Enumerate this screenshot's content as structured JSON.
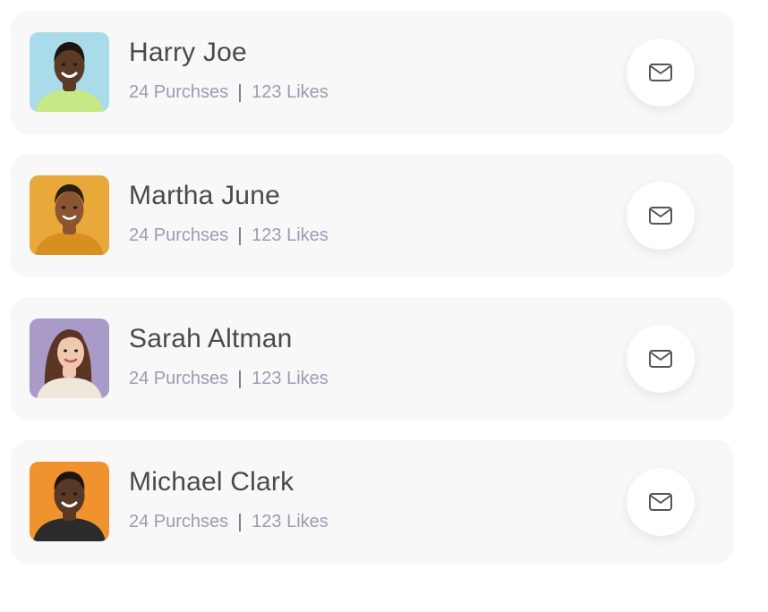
{
  "contacts": [
    {
      "name": "Harry Joe",
      "purchases": "24 Purchses",
      "likes": "123 Likes",
      "avatar_icon": "person-avatar",
      "avatar_bg": "#a9dbeb",
      "avatar_shirt": "#c6e887",
      "avatar_skin": "#5b3a26",
      "avatar_hair": "#1c1410",
      "mail_icon": "mail-icon"
    },
    {
      "name": "Martha June",
      "purchases": "24 Purchses",
      "likes": "123 Likes",
      "avatar_icon": "person-avatar",
      "avatar_bg": "#e9a93a",
      "avatar_shirt": "#d88f22",
      "avatar_skin": "#8a5530",
      "avatar_hair": "#2a1d14",
      "mail_icon": "mail-icon"
    },
    {
      "name": "Sarah Altman",
      "purchases": "24 Purchses",
      "likes": "123 Likes",
      "avatar_icon": "person-avatar",
      "avatar_bg": "#a99ac7",
      "avatar_shirt": "#efe7dc",
      "avatar_skin": "#f0c8ad",
      "avatar_hair": "#5b3424",
      "mail_icon": "mail-icon"
    },
    {
      "name": "Michael Clark",
      "purchases": "24 Purchses",
      "likes": "123 Likes",
      "avatar_icon": "person-avatar",
      "avatar_bg": "#f0932e",
      "avatar_shirt": "#2b2b2b",
      "avatar_skin": "#5a3826",
      "avatar_hair": "#1b1410",
      "mail_icon": "mail-icon"
    }
  ],
  "colors": {
    "card_bg": "#f8f8f8",
    "name_text": "#4a4a4a",
    "meta_text": "#9a9cb2",
    "mail_icon_stroke": "#555555"
  }
}
